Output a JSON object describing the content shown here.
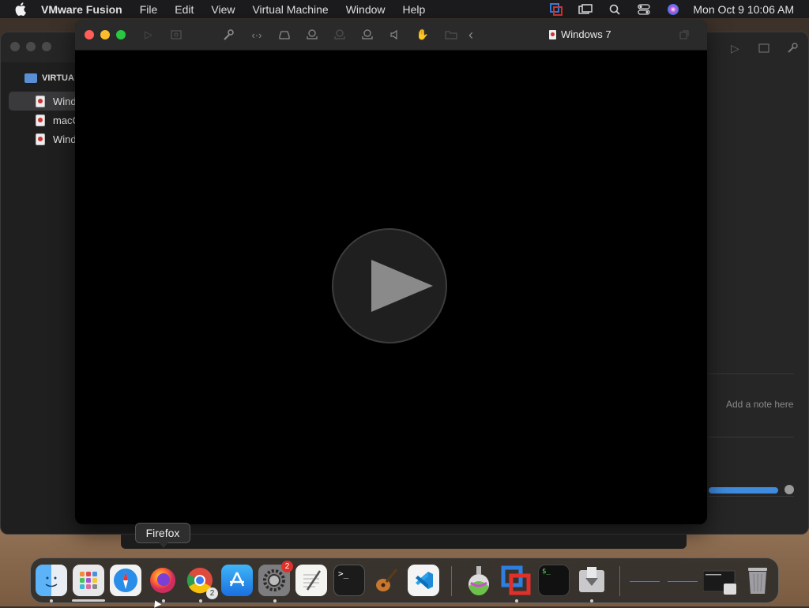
{
  "menubar": {
    "app_name": "VMware Fusion",
    "menus": [
      "File",
      "Edit",
      "View",
      "Virtual Machine",
      "Window",
      "Help"
    ],
    "clock": "Mon Oct 9  10:06 AM",
    "status_icons": [
      "vmware-status-icon",
      "screen-mirroring-icon",
      "search-icon",
      "control-center-icon",
      "siri-icon"
    ]
  },
  "library": {
    "section_label": "VIRTUA",
    "vms": [
      {
        "label": "Wind",
        "selected": true
      },
      {
        "label": "macO",
        "selected": false
      },
      {
        "label": "Wind",
        "selected": false
      }
    ],
    "note_placeholder": "Add a note here",
    "progress": 0.9
  },
  "vm_window": {
    "title": "Windows 7",
    "state": "paused"
  },
  "tooltip": {
    "text": "Firefox"
  },
  "dock": {
    "apps": [
      {
        "name": "finder",
        "icon": "finder-icon"
      },
      {
        "name": "launchpad",
        "icon": "launchpad-icon"
      },
      {
        "name": "safari",
        "icon": "safari-icon"
      },
      {
        "name": "firefox",
        "icon": "firefox-icon"
      },
      {
        "name": "chrome",
        "icon": "chrome-icon",
        "badge": "2"
      },
      {
        "name": "app-store",
        "icon": "app-store-icon"
      },
      {
        "name": "system-settings",
        "icon": "settings-gear-icon",
        "badge": "2"
      },
      {
        "name": "textedit",
        "icon": "textedit-icon"
      },
      {
        "name": "terminal",
        "icon": "terminal-icon"
      },
      {
        "name": "garageband",
        "icon": "guitar-icon"
      },
      {
        "name": "vscode",
        "icon": "vscode-icon"
      },
      {
        "name": "ventura-installer",
        "icon": "macos-installer-icon"
      },
      {
        "name": "vmware-fusion",
        "icon": "vmware-fusion-icon"
      },
      {
        "name": "activity-terminal",
        "icon": "console-icon"
      },
      {
        "name": "downloads",
        "icon": "downloads-icon"
      }
    ]
  }
}
